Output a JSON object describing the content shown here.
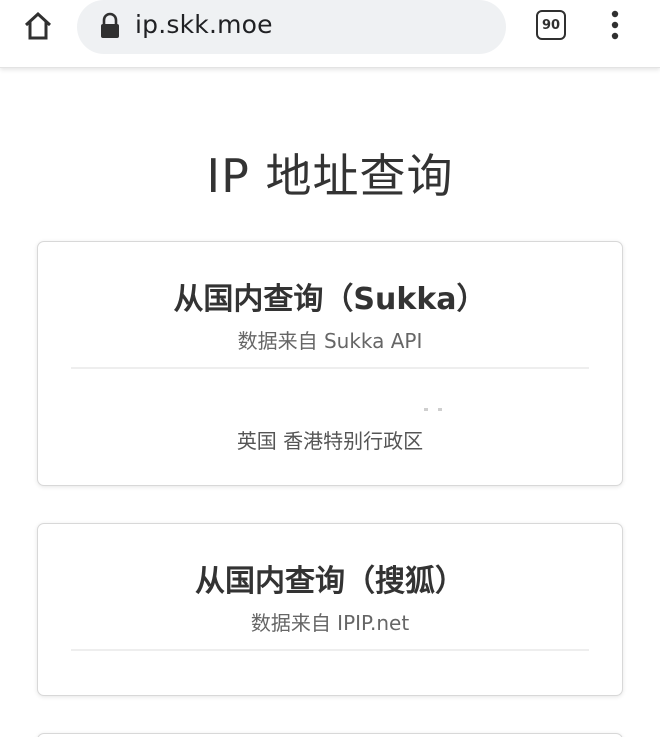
{
  "browser": {
    "url": "ip.skk.moe",
    "tab_count": "90"
  },
  "page": {
    "title": "IP 地址查询",
    "cards": [
      {
        "title": "从国内查询（Sukka）",
        "source": "数据来自 Sukka API",
        "result": "英国 香港特别行政区"
      },
      {
        "title": "从国内查询（搜狐）",
        "source": "数据来自 IPIP.net",
        "result": ""
      }
    ]
  },
  "icons": {
    "home": "home-icon",
    "lock": "lock-icon",
    "menu": "more-vert-icon",
    "tabs": "tab-switcher-icon"
  }
}
